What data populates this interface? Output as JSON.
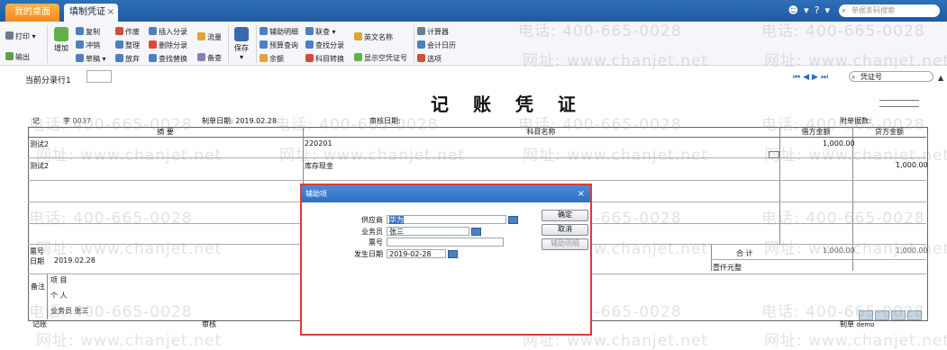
{
  "tabs": [
    {
      "label": "我的桌面"
    },
    {
      "label": "填制凭证",
      "close": "×"
    }
  ],
  "top_search_placeholder": "单据条码搜索",
  "toolbar": {
    "print": "打印",
    "export": "输出",
    "add": "增加",
    "copy": "复制",
    "reverse": "冲销",
    "draft": "草稿",
    "void": "作废",
    "tidy": "整理",
    "release": "放弃",
    "insert_entry": "插入分录",
    "delete_entry": "删除分录",
    "find_replace": "查找替换",
    "cashflow": "流量",
    "audit_check": "备查",
    "save": "保存",
    "aux_detail": "辅助明细",
    "budget_query": "预算查询",
    "balance": "余额",
    "linked_query": "联查",
    "find_entry": "查找分录",
    "account_convert": "科目转换",
    "english_name": "英文名称",
    "show_empty_voucher_no": "显示空凭证号",
    "calculator": "计算器",
    "accounting_calendar": "会计日历",
    "options": "选项"
  },
  "subbar": {
    "current_entry_label": "当前分录行1",
    "voucher_search_value": "凭证号"
  },
  "voucher": {
    "title": "记 账 凭 证",
    "type_label": "记",
    "no_label": "字",
    "no_value": "0037",
    "date_label": "制单日期:",
    "date_value": "2019.02.28",
    "audit_date_label": "审核日期:",
    "attachments_label": "附单据数:",
    "headers": {
      "summary": "摘 要",
      "account": "科目名称",
      "debit": "借方金额",
      "credit": "贷方金额"
    },
    "rows": [
      {
        "summary": "测试2",
        "account": "220201",
        "debit": "1,000.00",
        "credit": ""
      },
      {
        "summary": "测试2",
        "account": "库存现金",
        "debit": "",
        "credit": "1,000.00"
      }
    ],
    "bill_no_label": "票号",
    "bill_date_label": "日期",
    "bill_date_value": "2019.02.28",
    "total_label": "合 计",
    "total_debit": "1,000.00",
    "total_credit": "1,000.00",
    "amount_in_words": "壹仟元整",
    "remark_label": "备注",
    "project_label": "项 目",
    "person_label": "个 人",
    "salesman_label": "业务员",
    "salesman_value": "张三",
    "bookkeeper_label": "记账",
    "auditor_label": "审核",
    "preparer_label": "制单",
    "preparer_value": "demo"
  },
  "watermark": {
    "phone": "电话: 400-665-0028",
    "site": "网址: www.chanjet.net"
  },
  "dialog": {
    "title": "辅助项",
    "close": "×",
    "supplier_label": "供应商",
    "supplier_value": "华为",
    "salesman_label": "业务员",
    "salesman_value": "张三",
    "bill_no_label": "票号",
    "bill_no_value": "",
    "occur_date_label": "发生日期",
    "occur_date_value": "2019-02-28",
    "ok": "确定",
    "cancel": "取消",
    "aux_detail": "辅助明细"
  },
  "colors": {
    "accent": "#2f6fb7",
    "highlight": "#e03a3a",
    "tab_orange": "#f28a1a"
  }
}
